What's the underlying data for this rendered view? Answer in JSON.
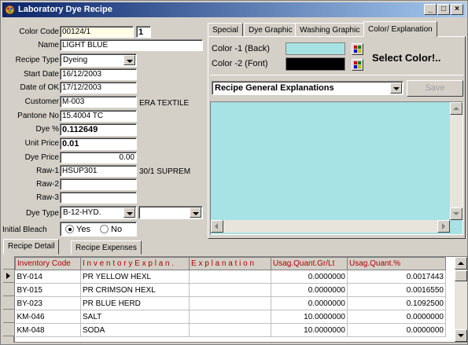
{
  "window": {
    "title": "Laboratory Dye Recipe",
    "controls": {
      "minimize": "_",
      "maximize": "□",
      "close": "×"
    }
  },
  "form": {
    "color_code": {
      "label": "Color Code",
      "value": "00124/1",
      "suffix": "1"
    },
    "name": {
      "label": "Name",
      "value": "LIGHT BLUE"
    },
    "recipe_type": {
      "label": "Recipe Type",
      "value": "Dyeing"
    },
    "start_date": {
      "label": "Start Date",
      "value": "16/12/2003"
    },
    "date_ok": {
      "label": "Date of OK",
      "value": "17/12/2003"
    },
    "customer": {
      "label": "Customer",
      "value": "M-003",
      "desc": "ERA TEXTILE"
    },
    "pantone": {
      "label": "Pantone No",
      "value": "15.4004 TC"
    },
    "dye_pct": {
      "label": "Dye %",
      "value": "0.112649"
    },
    "unit_price": {
      "label": "Unit Price",
      "value": "0.01"
    },
    "dye_price": {
      "label": "Dye Price",
      "value": "0.00"
    },
    "raw1": {
      "label": "Raw-1",
      "value": "HSUP301",
      "desc": "30/1 SUPREM"
    },
    "raw2": {
      "label": "Raw-2",
      "value": ""
    },
    "raw3": {
      "label": "Raw-3",
      "value": ""
    },
    "dye_type": {
      "label": "Dye Type",
      "value": "B-12-HYD.",
      "second_value": ""
    },
    "initial_bleach": {
      "label": "Initial Bleach",
      "yes": "Yes",
      "no": "No",
      "selected": "Yes"
    }
  },
  "right_tabs": [
    "Special",
    "Dye Graphic",
    "Washing Graphic",
    "Color/ Explanation"
  ],
  "color_panel": {
    "color1_label": "Color -1 (Back)",
    "color2_label": "Color -2 (Font)",
    "color1_hex": "#a7e2e4",
    "color2_hex": "#000000",
    "select_label": "Select Color!.."
  },
  "explanations": {
    "selected": "Recipe General Explanations",
    "save_label": "Save",
    "memo_color": "#a7e2e4"
  },
  "bottom_tabs": [
    "Recipe Detail",
    "Recipe Expenses"
  ],
  "grid": {
    "columns": [
      "Inventory Code",
      "I n v e n t o r y   E x p l a n .",
      "E x p l a n a t i o n",
      "Usag.Quant.Gr/Lt",
      "Usag.Quant.%"
    ],
    "rows": [
      [
        "BY-014",
        "PR YELLOW HEXL",
        "",
        "0.0000000",
        "0.0017443"
      ],
      [
        "BY-015",
        "PR CRIMSON HEXL",
        "",
        "0.0000000",
        "0.0016550"
      ],
      [
        "BY-023",
        "PR BLUE HERD",
        "",
        "0.0000000",
        "0.1092500"
      ],
      [
        "KM-046",
        "SALT",
        "",
        "10.0000000",
        "0.0000000"
      ],
      [
        "KM-048",
        "SODA",
        "",
        "10.0000000",
        "0.0000000"
      ]
    ]
  }
}
